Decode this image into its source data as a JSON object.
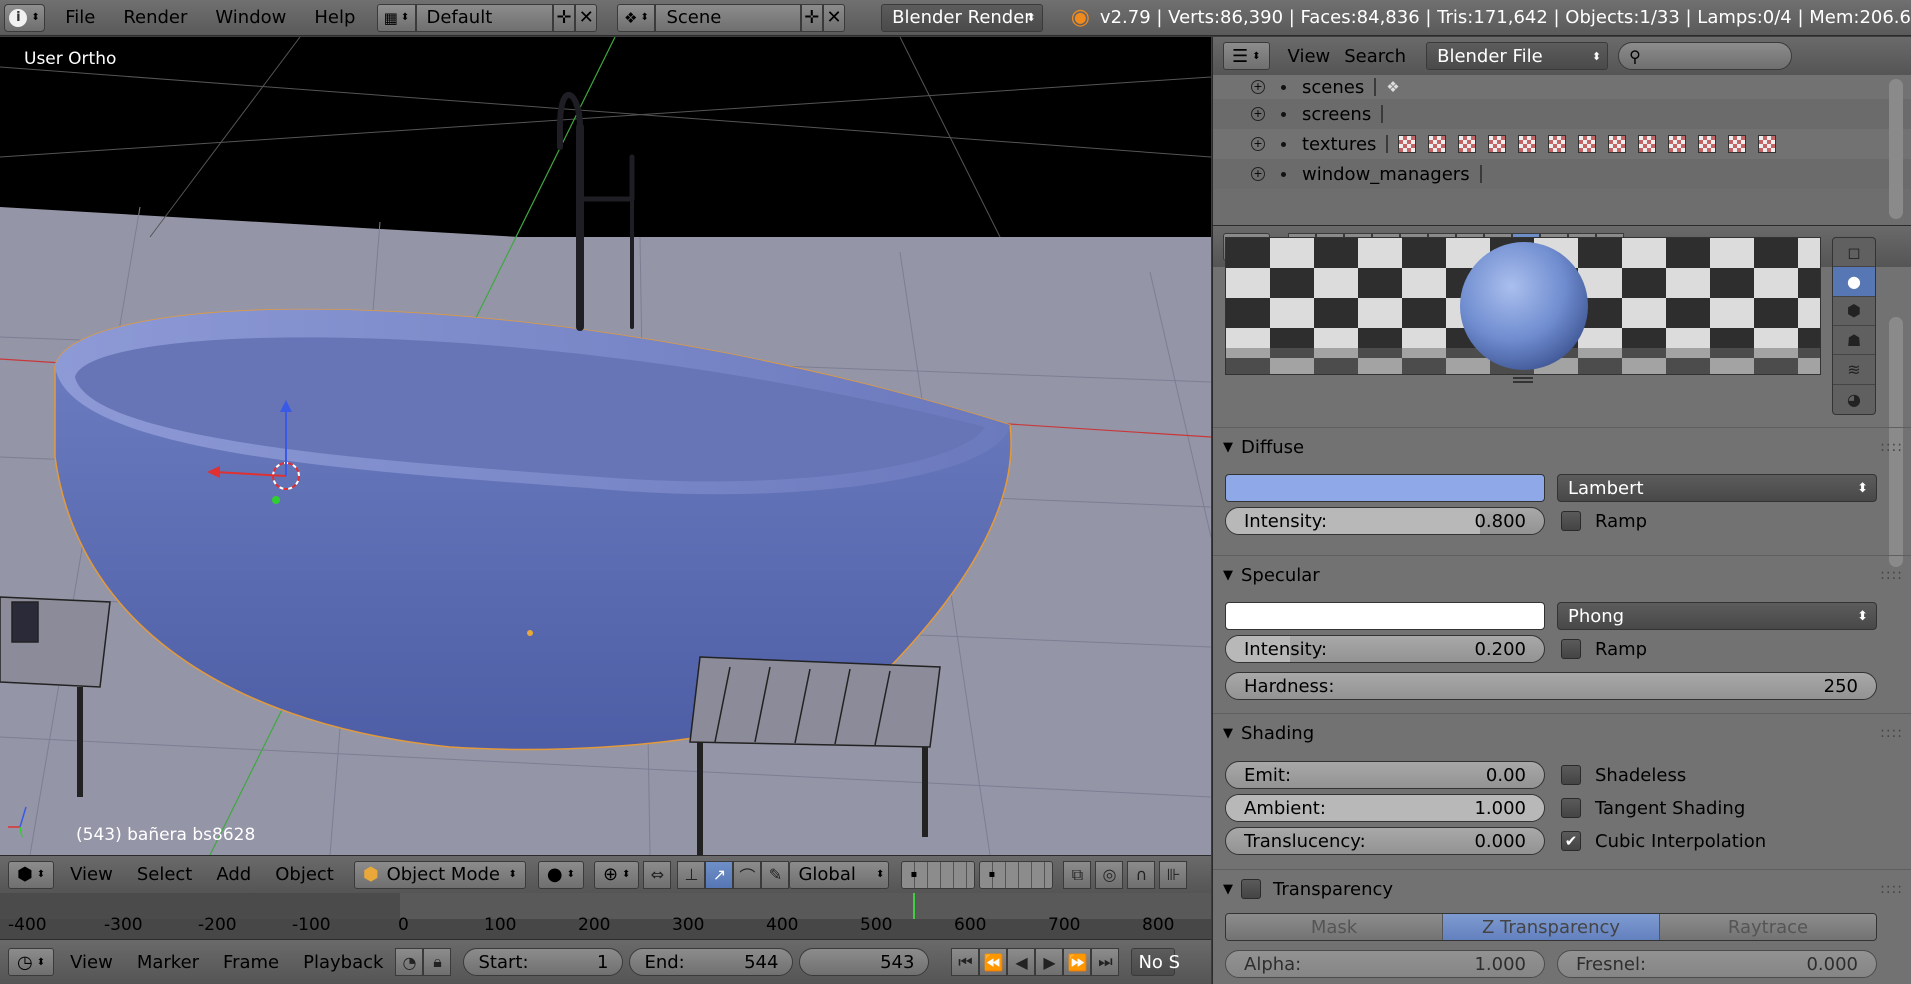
{
  "topbar": {
    "menus": [
      "File",
      "Render",
      "Window",
      "Help"
    ],
    "layout": "Default",
    "scene": "Scene",
    "engine": "Blender Render",
    "stats": "v2.79 | Verts:86,390 | Faces:84,836 | Tris:171,642 | Objects:1/33 | Lamps:0/4 | Mem:206.6"
  },
  "viewport": {
    "view_label": "User Ortho",
    "object_label": "(543) bañera bs8628"
  },
  "view_header": {
    "menus": [
      "View",
      "Select",
      "Add",
      "Object"
    ],
    "mode": "Object Mode",
    "orientation": "Global"
  },
  "timeline": {
    "ticks": [
      "-400",
      "-300",
      "-200",
      "-100",
      "0",
      "100",
      "200",
      "300",
      "400",
      "500",
      "600",
      "700",
      "800"
    ],
    "menus": [
      "View",
      "Marker",
      "Frame",
      "Playback"
    ],
    "start_label": "Start:",
    "start": "1",
    "end_label": "End:",
    "end": "544",
    "current": "543",
    "sync": "No S"
  },
  "outliner": {
    "menus": [
      "View",
      "Search"
    ],
    "display": "Blender File",
    "rows": [
      "scenes",
      "screens",
      "textures",
      "window_managers"
    ]
  },
  "material": {
    "diffuse": {
      "title": "Diffuse",
      "color": "#8ea8e8",
      "shader": "Lambert",
      "intensity_label": "Intensity:",
      "intensity": "0.800",
      "ramp": "Ramp"
    },
    "specular": {
      "title": "Specular",
      "color": "#ffffff",
      "shader": "Phong",
      "intensity_label": "Intensity:",
      "intensity": "0.200",
      "ramp": "Ramp",
      "hardness_label": "Hardness:",
      "hardness": "250"
    },
    "shading": {
      "title": "Shading",
      "emit_label": "Emit:",
      "emit": "0.00",
      "ambient_label": "Ambient:",
      "ambient": "1.000",
      "translucency_label": "Translucency:",
      "translucency": "0.000",
      "shadeless": "Shadeless",
      "tangent": "Tangent Shading",
      "cubic": "Cubic Interpolation"
    },
    "transparency": {
      "title": "Transparency",
      "modes": [
        "Mask",
        "Z Transparency",
        "Raytrace"
      ],
      "alpha_label": "Alpha:",
      "alpha": "1.000",
      "fresnel_label": "Fresnel:",
      "fresnel": "0.000"
    }
  }
}
